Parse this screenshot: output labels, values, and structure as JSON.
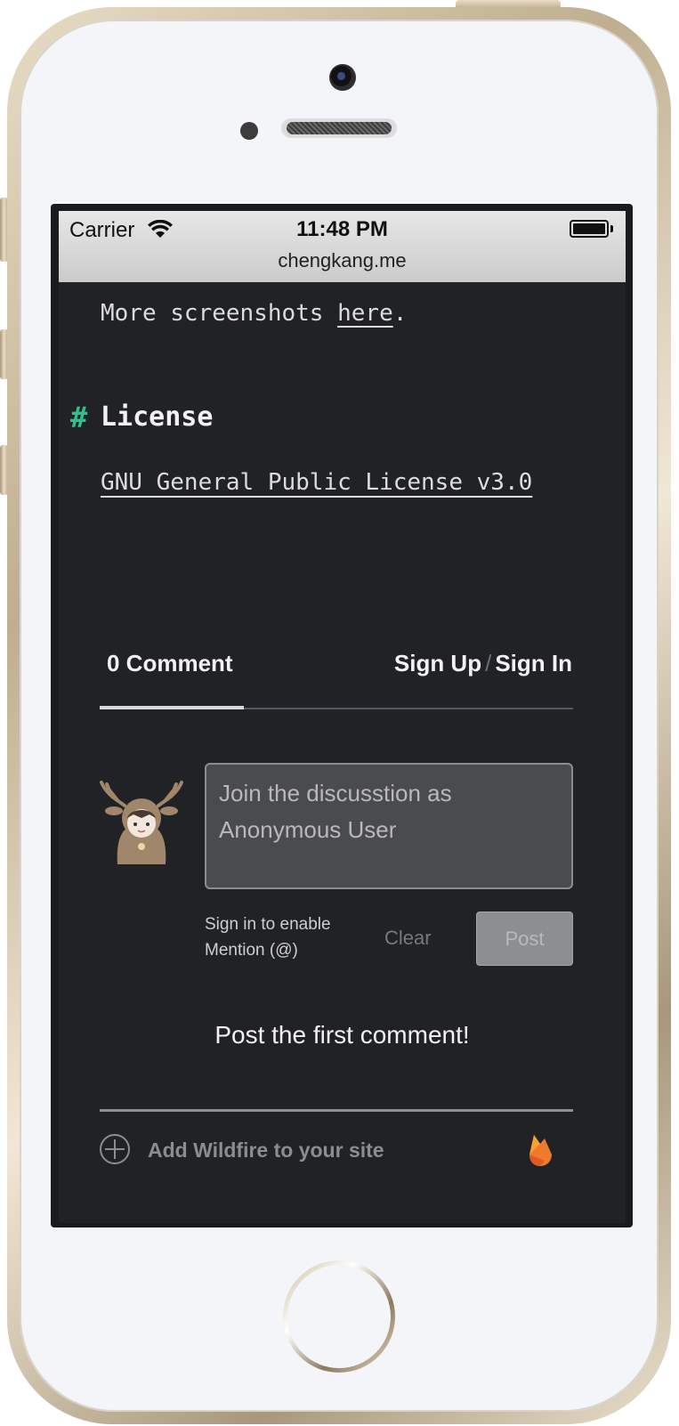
{
  "status_bar": {
    "carrier": "Carrier",
    "time": "11:48 PM",
    "url": "chengkang.me"
  },
  "content": {
    "more_prefix": "More screenshots ",
    "more_link": "here",
    "more_suffix": ".",
    "hash": "#",
    "license_title": "License",
    "license_link": "GNU General Public License v3.0"
  },
  "comments": {
    "count_label": "0 Comment",
    "sign_up": "Sign Up",
    "separator": "/",
    "sign_in": "Sign In",
    "placeholder": "Join the discusstion as Anonymous User",
    "hint_line1": "Sign in to enable",
    "hint_line2": "Mention (@)",
    "clear_label": "Clear",
    "post_label": "Post",
    "empty_message": "Post the first comment!",
    "footer_link": "Add Wildfire to your site"
  },
  "icons": {
    "wifi": "wifi-icon",
    "battery": "battery-icon",
    "avatar": "deer-avatar-icon",
    "plus": "plus-circle-icon",
    "flame": "firebase-flame-icon"
  },
  "colors": {
    "accent_hash": "#2fc18c",
    "background": "#212225",
    "flame": "#f07a2c"
  }
}
